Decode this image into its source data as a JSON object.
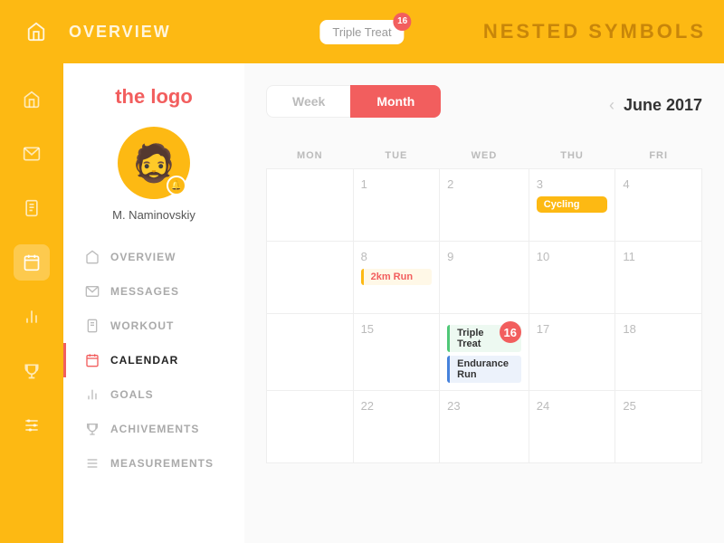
{
  "topbar": {
    "title": "OVERVIEW",
    "app_name": "NESTED SYMBOLS",
    "notification_text": "Triple Treat",
    "notification_count": "16"
  },
  "sidebar": {
    "logo": "the logo",
    "user_name": "M. Naminovskiy",
    "nav_items": [
      {
        "label": "OVERVIEW",
        "icon": "home",
        "active": false
      },
      {
        "label": "MESSAGES",
        "icon": "mail",
        "active": false
      },
      {
        "label": "WORKOUT",
        "icon": "clipboard",
        "active": false
      },
      {
        "label": "CALENDAR",
        "icon": "calendar",
        "active": true
      },
      {
        "label": "GOALS",
        "icon": "bar-chart",
        "active": false
      },
      {
        "label": "ACHIVEMENTS",
        "icon": "trophy",
        "active": false
      },
      {
        "label": "MEASUREMENTS",
        "icon": "sliders",
        "active": false
      }
    ]
  },
  "tabs": {
    "week_label": "Week",
    "month_label": "Month"
  },
  "calendar": {
    "title": "June 2017",
    "days_headers": [
      "MON",
      "TUE",
      "WED",
      "THU"
    ],
    "weeks": [
      [
        {
          "day": "",
          "events": []
        },
        {
          "day": "1",
          "events": []
        },
        {
          "day": "2",
          "events": []
        },
        {
          "day": "3",
          "events": [
            {
              "label": "Cycling",
              "type": "orange"
            }
          ]
        },
        {
          "day": "4",
          "events": []
        }
      ],
      [
        {
          "day": "",
          "events": []
        },
        {
          "day": "8",
          "events": [
            {
              "label": "2km Run",
              "type": "outline-orange"
            }
          ]
        },
        {
          "day": "9",
          "events": []
        },
        {
          "day": "10",
          "events": []
        },
        {
          "day": "11",
          "events": []
        }
      ],
      [
        {
          "day": "",
          "events": []
        },
        {
          "day": "15",
          "events": []
        },
        {
          "day": "16",
          "events": [
            {
              "label": "Triple Treat",
              "type": "outline-green"
            },
            {
              "label": "Endurance Run",
              "type": "outline-blue"
            }
          ],
          "today": true
        },
        {
          "day": "17",
          "events": []
        },
        {
          "day": "18",
          "events": []
        }
      ],
      [
        {
          "day": "",
          "events": []
        },
        {
          "day": "22",
          "events": []
        },
        {
          "day": "23",
          "events": []
        },
        {
          "day": "24",
          "events": []
        },
        {
          "day": "25",
          "events": []
        }
      ]
    ]
  },
  "icon_strip": {
    "icons": [
      "home",
      "mail",
      "clipboard",
      "calendar",
      "bar-chart",
      "trophy",
      "sliders"
    ]
  }
}
